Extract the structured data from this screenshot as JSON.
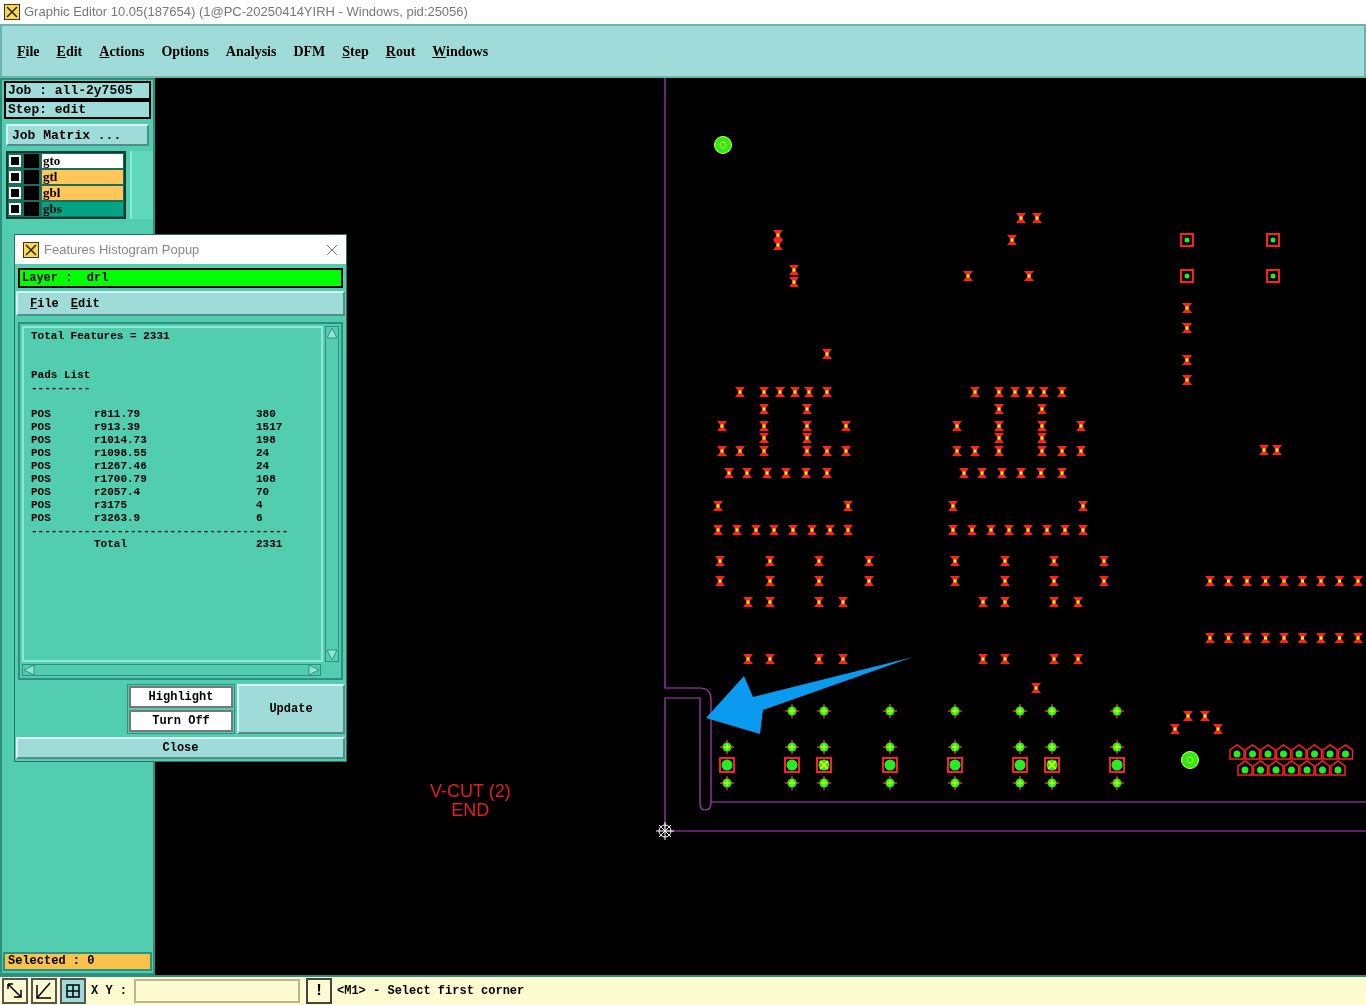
{
  "window": {
    "title": "Graphic Editor 10.05(187654) (1@PC-20250414YIRH - Windows, pid:25056)"
  },
  "menu": [
    {
      "label": "File",
      "mnemonic": true
    },
    {
      "label": "Edit",
      "mnemonic": true
    },
    {
      "label": "Actions",
      "mnemonic": true
    },
    {
      "label": "Options",
      "mnemonic": false
    },
    {
      "label": "Analysis",
      "mnemonic": false
    },
    {
      "label": "DFM",
      "mnemonic": false
    },
    {
      "label": "Step",
      "mnemonic": true
    },
    {
      "label": "Rout",
      "mnemonic": true
    },
    {
      "label": "Windows",
      "mnemonic": true
    }
  ],
  "sidebar": {
    "job": "Job : all-2y7505",
    "step": "Step: edit",
    "job_matrix": "Job Matrix ...",
    "layers": [
      {
        "name": "gto",
        "color": "#ffffff",
        "checked": false
      },
      {
        "name": "gtl",
        "color": "#ffc659",
        "checked": false
      },
      {
        "name": "gbl",
        "color": "#ffc659",
        "checked": false
      },
      {
        "name": "gbs",
        "color": "#04a385",
        "checked": false
      }
    ],
    "selected": "Selected : 0"
  },
  "canvas": {
    "labels": [
      "V-CUT (2)",
      "END"
    ]
  },
  "popup": {
    "title": "Features Histogram Popup",
    "layer": "Layer :  drl",
    "menu": [
      {
        "label": "File"
      },
      {
        "label": "Edit"
      }
    ],
    "total": "Total Features = 2331",
    "section": "Pads List",
    "section_rule": "---------",
    "rows": [
      {
        "type": "POS",
        "symbol": "r811.79",
        "count": "380"
      },
      {
        "type": "POS",
        "symbol": "r913.39",
        "count": "1517"
      },
      {
        "type": "POS",
        "symbol": "r1014.73",
        "count": "198"
      },
      {
        "type": "POS",
        "symbol": "r1098.55",
        "count": "24"
      },
      {
        "type": "POS",
        "symbol": "r1267.46",
        "count": "24"
      },
      {
        "type": "POS",
        "symbol": "r1700.79",
        "count": "108"
      },
      {
        "type": "POS",
        "symbol": "r2057.4",
        "count": "70"
      },
      {
        "type": "POS",
        "symbol": "r3175",
        "count": "4"
      },
      {
        "type": "POS",
        "symbol": "r3263.9",
        "count": "6"
      }
    ],
    "rule": "---------------------------------------",
    "total_label": "Total",
    "total_count": "2331",
    "buttons": {
      "highlight": "Highlight",
      "turn_off": "Turn Off",
      "update": "Update",
      "close": "Close"
    }
  },
  "status_bar": {
    "xy_label": "X Y :",
    "alert": "!",
    "message": "<M1> - Select first corner"
  }
}
